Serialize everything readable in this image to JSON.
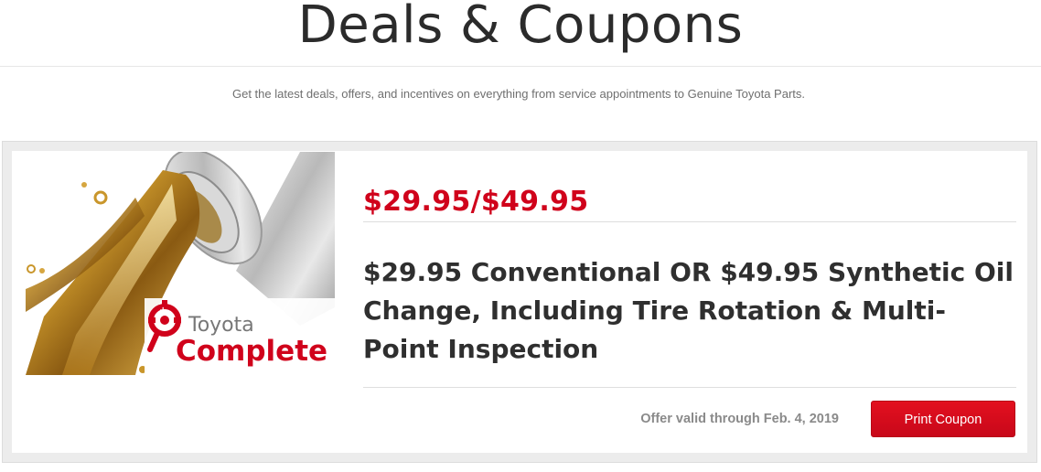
{
  "header": {
    "title": "Deals & Coupons",
    "subtitle": "Get the latest deals, offers, and incentives on everything from service appointments to Genuine Toyota Parts."
  },
  "coupon": {
    "image": {
      "brand_top": "Toyota",
      "brand_bottom": "Complete",
      "logo_icon": "gear-wrench-icon"
    },
    "price": "$29.95/$49.95",
    "title": "$29.95 Conventional OR $49.95 Synthetic Oil Change, Including Tire Rotation & Multi-Point Inspection",
    "validity": "Offer valid through Feb. 4, 2019",
    "print_label": "Print Coupon"
  },
  "colors": {
    "accent_red": "#d0021b",
    "button_red": "#e3101f",
    "oil_gold": "#c9962b"
  }
}
